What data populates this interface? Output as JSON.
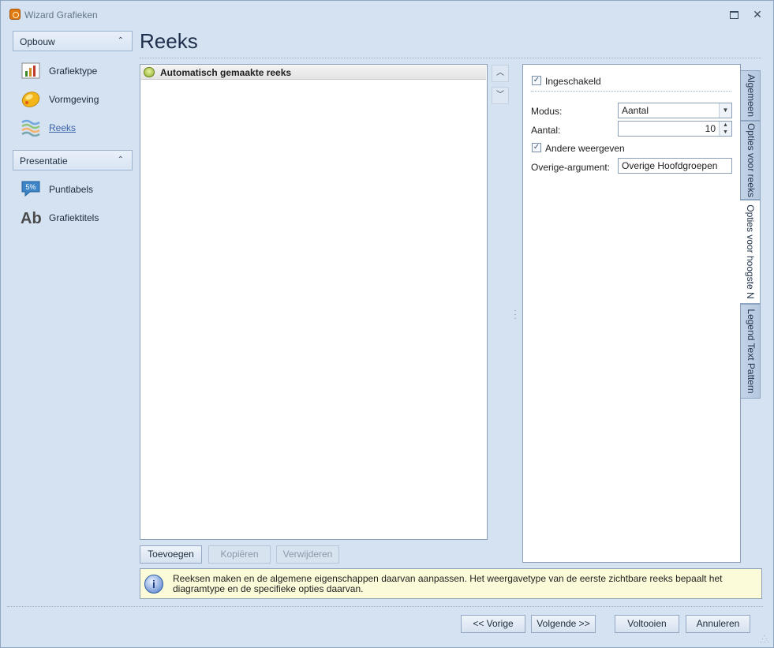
{
  "window": {
    "title": "Wizard Grafieken"
  },
  "nav": {
    "groups": [
      {
        "label": "Opbouw",
        "items": [
          {
            "label": "Grafiektype",
            "icon": "chart-type-icon"
          },
          {
            "label": "Vormgeving",
            "icon": "appearance-icon"
          },
          {
            "label": "Reeks",
            "icon": "series-icon",
            "active": true
          }
        ]
      },
      {
        "label": "Presentatie",
        "items": [
          {
            "label": "Puntlabels",
            "icon": "point-labels-icon",
            "badge": "5%"
          },
          {
            "label": "Grafiektitels",
            "icon": "chart-titles-icon",
            "glyph": "Ab"
          }
        ]
      }
    ]
  },
  "page": {
    "title": "Reeks"
  },
  "series_list": {
    "items": [
      "Automatisch gemaakte reeks"
    ]
  },
  "list_buttons": {
    "add": "Toevoegen",
    "copy": "Kopiëren",
    "remove": "Verwijderen"
  },
  "props": {
    "enabled_label": "Ingeschakeld",
    "enabled_checked": true,
    "mode_label": "Modus:",
    "mode_value": "Aantal",
    "count_label": "Aantal:",
    "count_value": "10",
    "show_others_label": "Andere weergeven",
    "show_others_checked": true,
    "others_arg_label": "Overige-argument:",
    "others_arg_value": "Overige Hoofdgroepen"
  },
  "tabs": [
    "Algemeen",
    "Opties voor reeks",
    "Opties voor hoogste N",
    "Legend Text Pattern"
  ],
  "active_tab": "Opties voor hoogste N",
  "info": {
    "text": "Reeksen maken en de algemene eigenschappen daarvan aanpassen. Het weergavetype van de eerste zichtbare reeks bepaalt het diagramtype en de specifieke opties daarvan."
  },
  "footer": {
    "prev": "<< Vorige",
    "next": "Volgende >>",
    "finish": "Voltooien",
    "cancel": "Annuleren"
  },
  "colors": {
    "accent": "#3b63a8",
    "window_bg": "#d5e2f1",
    "info_bg": "#fcfbd9"
  }
}
